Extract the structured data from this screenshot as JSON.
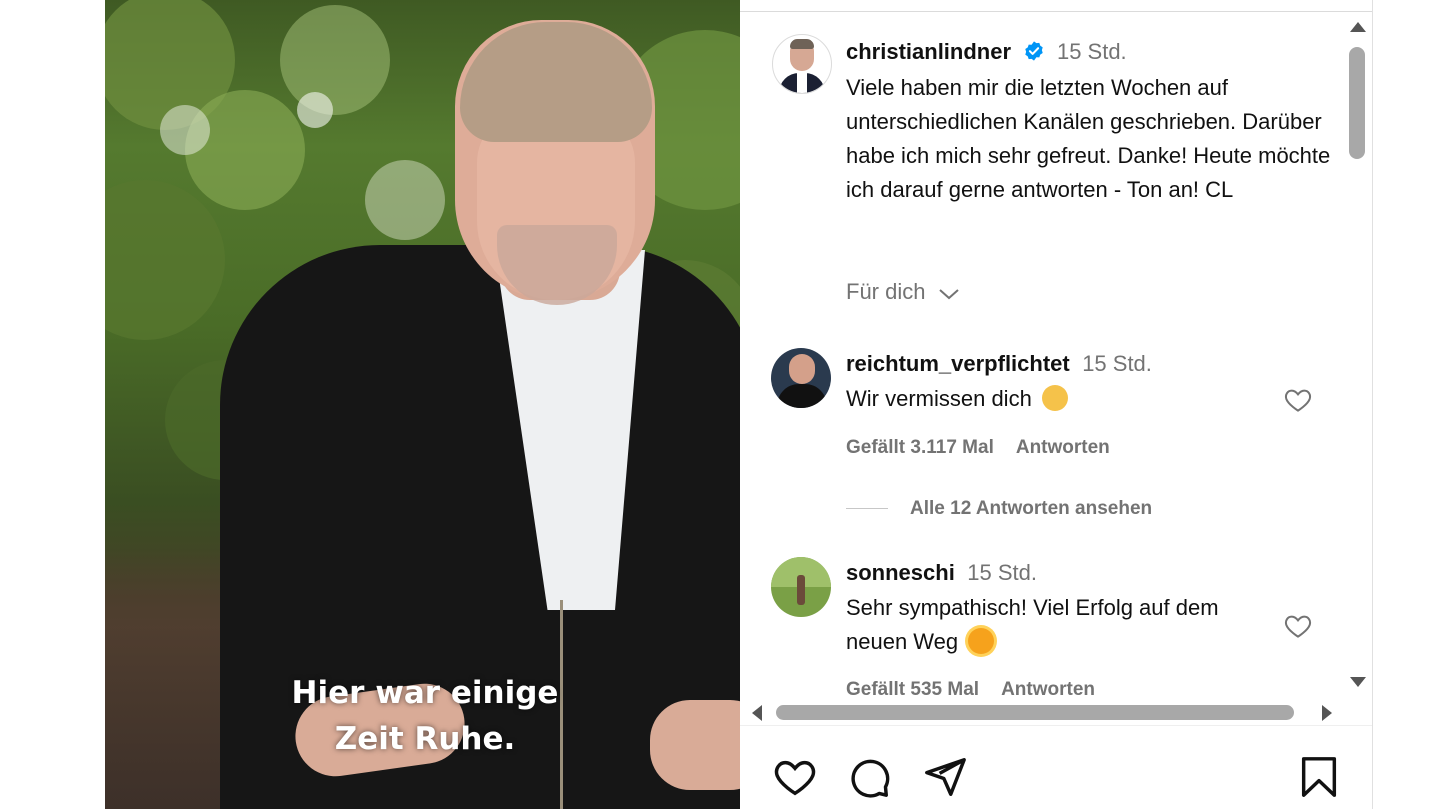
{
  "video": {
    "caption_line1": "Hier war einige",
    "caption_line2": "Zeit Ruhe."
  },
  "post": {
    "username": "christianlindner",
    "verified": true,
    "time": "15 Std.",
    "text": "Viele haben mir die letzten Wochen auf unterschiedlichen Kanälen geschrieben. Darüber habe ich mich sehr gefreut. Danke! Heute möchte ich darauf gerne antworten - Ton an! CL",
    "for_you_label": "Für dich"
  },
  "comments": [
    {
      "username": "reichtum_verpflichtet",
      "time": "15 Std.",
      "text": "Wir vermissen dich",
      "emoji": "sad-face-emoji",
      "likes": "Gefällt 3.117 Mal",
      "reply_label": "Antworten",
      "view_replies": "Alle 12 Antworten ansehen"
    },
    {
      "username": "sonneschi",
      "time": "15 Std.",
      "text": "Sehr sympathisch! Viel Erfolg auf dem neuen Weg",
      "emoji": "sun-emoji",
      "likes": "Gefällt 535 Mal",
      "reply_label": "Antworten"
    }
  ],
  "actions": [
    "heart-icon",
    "comment-icon",
    "share-icon",
    "bookmark-icon"
  ],
  "colors": {
    "verified_blue": "#0095f6",
    "secondary_text": "#737373",
    "primary_text": "#111111"
  }
}
